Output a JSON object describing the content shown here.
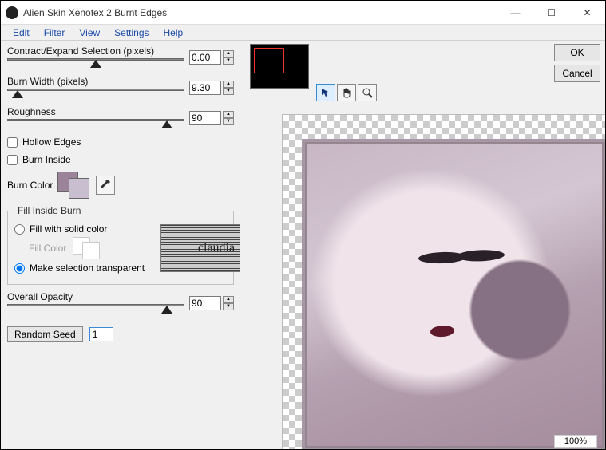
{
  "window": {
    "title": "Alien Skin Xenofex 2 Burnt Edges"
  },
  "menubar": {
    "items": [
      "Edit",
      "Filter",
      "View",
      "Settings",
      "Help"
    ]
  },
  "buttons": {
    "ok": "OK",
    "cancel": "Cancel",
    "random_seed": "Random Seed"
  },
  "params": {
    "contract": {
      "label": "Contract/Expand Selection (pixels)",
      "value": "0.00",
      "thumb_pct": 50
    },
    "burn_width": {
      "label": "Burn Width (pixels)",
      "value": "9.30",
      "thumb_pct": 6
    },
    "roughness": {
      "label": "Roughness",
      "value": "90",
      "thumb_pct": 90
    },
    "overall_opacity": {
      "label": "Overall Opacity",
      "value": "90",
      "thumb_pct": 90
    }
  },
  "checks": {
    "hollow_edges": {
      "label": "Hollow Edges",
      "checked": false
    },
    "burn_inside": {
      "label": "Burn Inside",
      "checked": false
    }
  },
  "burn_color": {
    "label": "Burn Color",
    "fg": "#9b8499",
    "bg": "#c9bdd0"
  },
  "fill_inside": {
    "legend": "Fill Inside Burn",
    "solid_label": "Fill with solid color",
    "fillcolor_label": "Fill Color",
    "transparent_label": "Make selection transparent",
    "selected": "transparent"
  },
  "seed": {
    "value": "1"
  },
  "status": {
    "zoom": "100%"
  },
  "watermark": "claudia"
}
